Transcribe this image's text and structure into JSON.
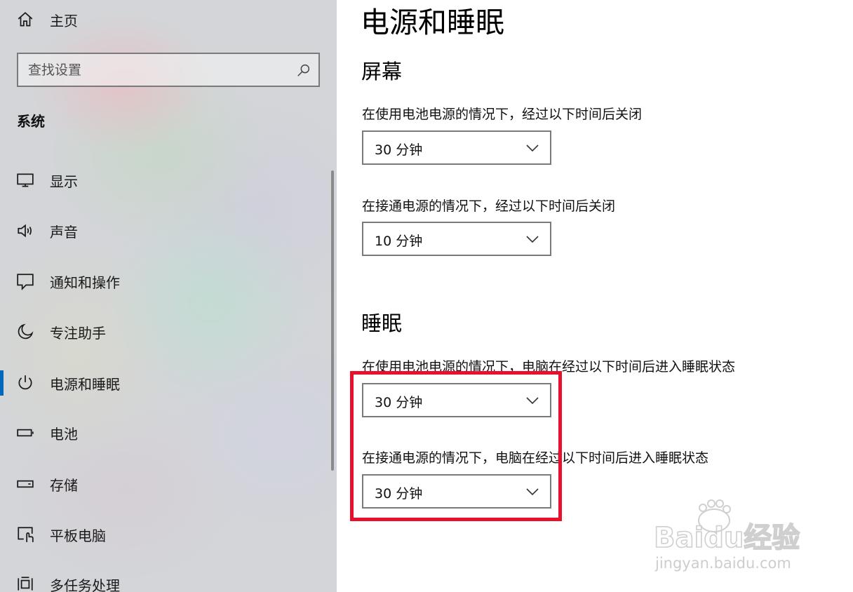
{
  "sidebar": {
    "home_label": "主页",
    "search_placeholder": "查找设置",
    "section_title": "系统",
    "items": [
      {
        "label": "显示",
        "icon": "monitor-icon"
      },
      {
        "label": "声音",
        "icon": "speaker-icon"
      },
      {
        "label": "通知和操作",
        "icon": "notification-icon"
      },
      {
        "label": "专注助手",
        "icon": "moon-icon"
      },
      {
        "label": "电源和睡眠",
        "icon": "power-icon",
        "active": true
      },
      {
        "label": "电池",
        "icon": "battery-icon"
      },
      {
        "label": "存储",
        "icon": "storage-icon"
      },
      {
        "label": "平板电脑",
        "icon": "tablet-icon"
      },
      {
        "label": "多任务处理",
        "icon": "multitask-icon"
      }
    ]
  },
  "main": {
    "title": "电源和睡眠",
    "screen": {
      "title": "屏幕",
      "battery_label": "在使用电池电源的情况下，经过以下时间后关闭",
      "battery_value": "30 分钟",
      "plugged_label": "在接通电源的情况下，经过以下时间后关闭",
      "plugged_value": "10 分钟"
    },
    "sleep": {
      "title": "睡眠",
      "battery_label": "在使用电池电源的情况下，电脑在经过以下时间后进入睡眠状态",
      "battery_value": "30 分钟",
      "plugged_label": "在接通电源的情况下，电脑在经过以下时间后进入睡眠状态",
      "plugged_value": "30 分钟"
    }
  },
  "watermark": {
    "brand": "Baidu经验",
    "url": "jingyan.baidu.com"
  },
  "colors": {
    "accent": "#0067c0",
    "highlight": "#e8112d"
  }
}
